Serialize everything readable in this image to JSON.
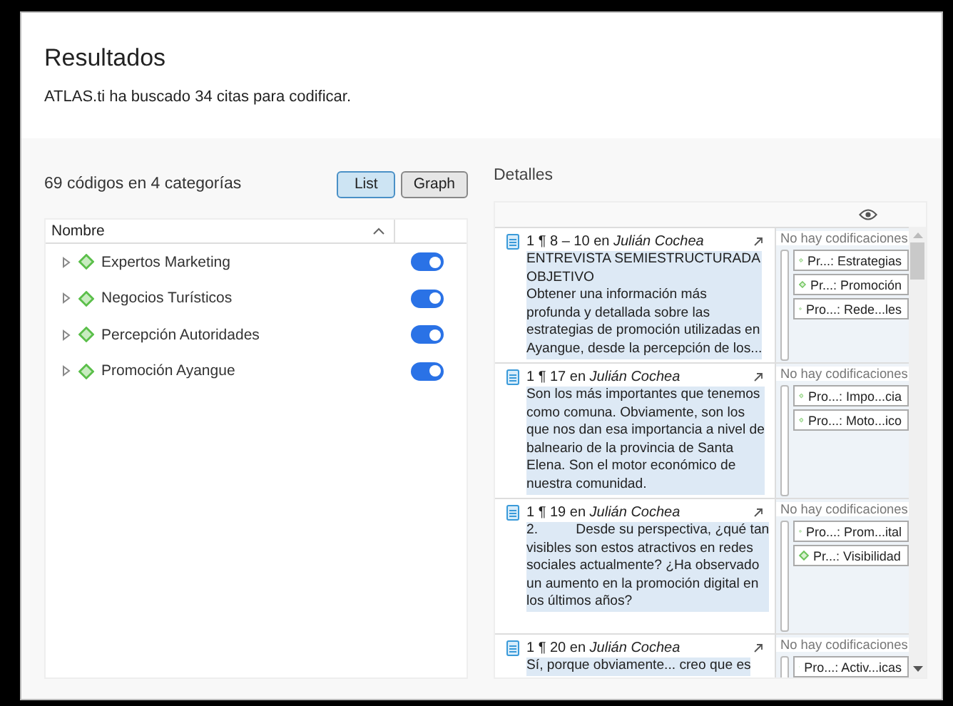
{
  "header": {
    "title": "Resultados",
    "subtitle": "ATLAS.ti ha buscado 34 citas para codificar."
  },
  "codes_panel": {
    "summary": "69 códigos en 4 categorías",
    "view_buttons": [
      {
        "label": "List",
        "selected": true
      },
      {
        "label": "Graph",
        "selected": false
      }
    ],
    "tree": {
      "column": "Nombre",
      "items": [
        {
          "label": "Expertos Marketing",
          "expanded": false,
          "on": true
        },
        {
          "label": "Negocios Turísticos",
          "expanded": false,
          "on": true
        },
        {
          "label": "Percepción Autoridades",
          "expanded": false,
          "on": true
        },
        {
          "label": "Promoción Ayangue",
          "expanded": false,
          "on": true
        }
      ]
    }
  },
  "details": {
    "title": "Detalles",
    "quotes": [
      {
        "ref": "1 ¶ 8 – 10 en",
        "document": "Julián Cochea",
        "text": "ENTREVISTA SEMIESTRUCTURADA\nOBJETIVO\nObtener una información más\nprofunda y detallada sobre las\nestrategias de promoción utilizadas en\nAyangue, desde la percepción de los...",
        "codings": "No hay codificaciones",
        "codes": [
          "Pr...: Estrategias",
          "Pr...: Promoción",
          "Pro...: Rede...les"
        ]
      },
      {
        "ref": "1 ¶ 17 en",
        "document": "Julián Cochea",
        "text": "Son los más importantes que tenemos\ncomo comuna. Obviamente, son los\nque nos dan esa importancia a nivel de\nbalneario de la provincia de Santa\nElena. Son el motor económico de\nnuestra comunidad.",
        "codings": "No hay codificaciones",
        "codes": [
          "Pro...: Impo...cia",
          "Pro...: Moto...ico"
        ]
      },
      {
        "ref": "1 ¶ 19 en",
        "document": "Julián Cochea",
        "text": "2.          Desde su perspectiva, ¿qué tan\nvisibles son estos atractivos en redes\nsociales actualmente? ¿Ha observado\nun aumento en la promoción digital en\nlos últimos años?",
        "codings": "No hay codificaciones",
        "codes": [
          "Pro...: Prom...ital",
          "Pr...: Visibilidad"
        ]
      },
      {
        "ref": "1 ¶ 20 en",
        "document": "Julián Cochea",
        "text": "Sí, porque obviamente... creo que es",
        "codings": "No hay codificaciones",
        "codes": [
          "Pro...: Activ...icas"
        ]
      }
    ]
  }
}
